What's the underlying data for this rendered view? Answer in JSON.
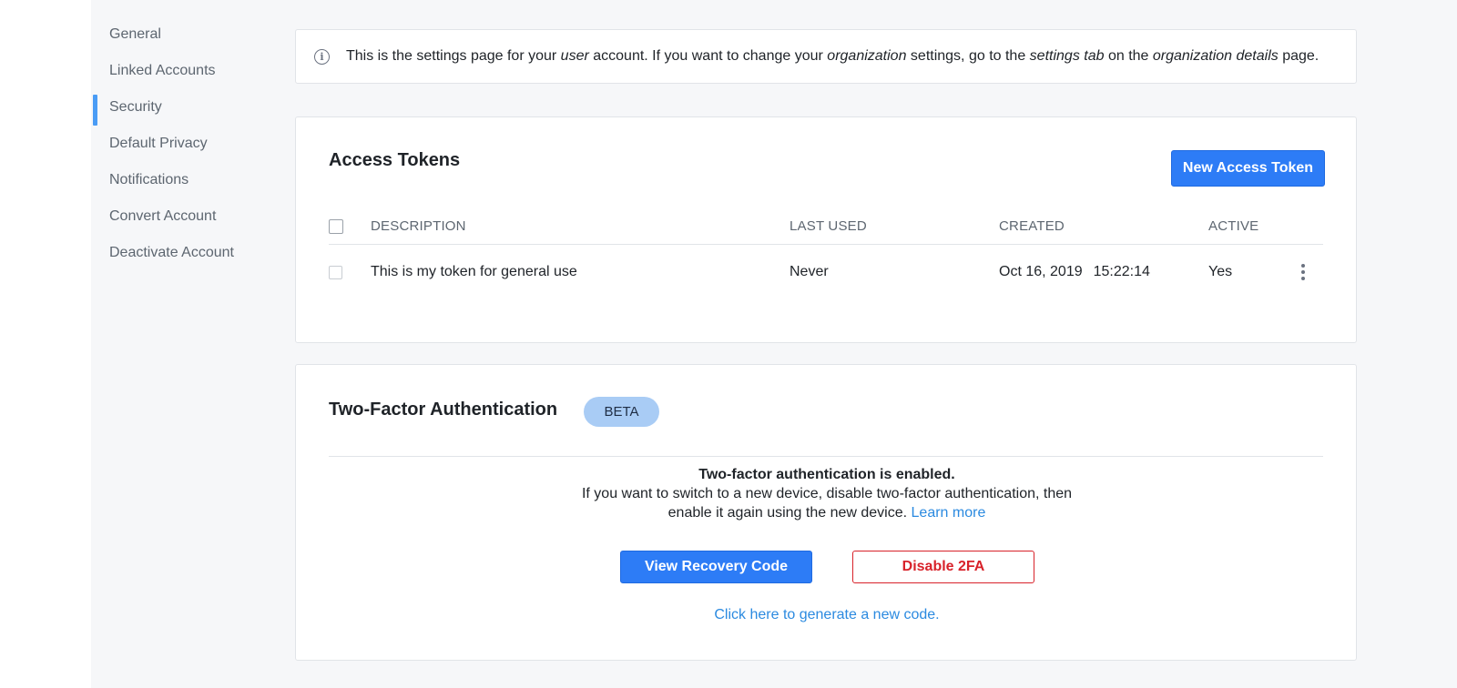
{
  "sidebar": {
    "items": [
      {
        "label": "General"
      },
      {
        "label": "Linked Accounts"
      },
      {
        "label": "Security"
      },
      {
        "label": "Default Privacy"
      },
      {
        "label": "Notifications"
      },
      {
        "label": "Convert Account"
      },
      {
        "label": "Deactivate Account"
      }
    ],
    "active_index": 2
  },
  "banner": {
    "icon": "info-icon",
    "icon_glyph": "i",
    "parts": [
      "This is the settings page for your ",
      "user",
      " account. If you want to change your ",
      "organization",
      " settings, go to the ",
      "settings tab",
      " on the ",
      "organization details",
      " page."
    ]
  },
  "access_tokens": {
    "title": "Access Tokens",
    "new_button_label": "New Access Token",
    "columns": {
      "description": "DESCRIPTION",
      "last_used": "LAST USED",
      "created": "CREATED",
      "active": "ACTIVE"
    },
    "rows": [
      {
        "description": "This is my token for general use",
        "last_used": "Never",
        "created_date": "Oct 16, 2019",
        "created_time": "15:22:14",
        "active": "Yes"
      }
    ],
    "row_menu_icon": "kebab-menu-icon"
  },
  "two_factor": {
    "title": "Two-Factor Authentication",
    "badge": "BETA",
    "status_line": "Two-factor authentication is enabled.",
    "instruction_line1": "If you want to switch to a new device, disable two-factor authentication, then",
    "instruction_line2": "enable it again using the new device.",
    "learn_more": "Learn more",
    "view_recovery_label": "View Recovery Code",
    "disable_label": "Disable 2FA",
    "generate_link": "Click here to generate a new code."
  },
  "colors": {
    "primary": "#2d7cf6",
    "danger": "#d8222a",
    "link": "#2b8ae0",
    "active_indicator": "#4a9cf5",
    "badge_bg": "#a9ccf5"
  }
}
